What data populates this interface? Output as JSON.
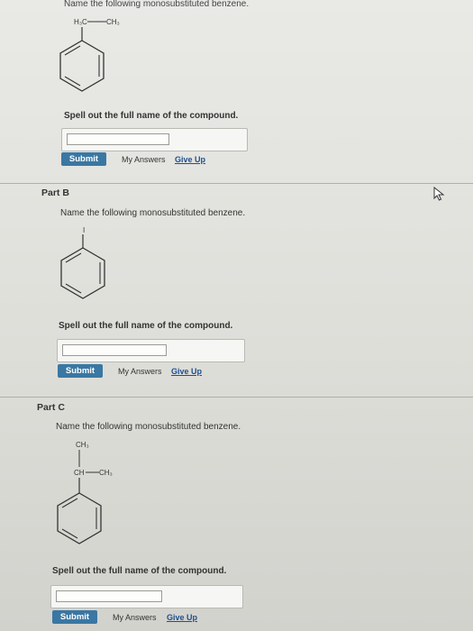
{
  "part_a": {
    "instruction": "Name the following monosubstituted benzene.",
    "sub_left": "H₃C",
    "sub_right": "CH₃",
    "prompt": "Spell out the full name of the compound.",
    "submit_label": "Submit",
    "my_answers_label": "My Answers",
    "give_up_label": "Give Up"
  },
  "part_b": {
    "title": "Part B",
    "instruction": "Name the following monosubstituted benzene.",
    "substituent": "I",
    "prompt": "Spell out the full name of the compound.",
    "submit_label": "Submit",
    "my_answers_label": "My Answers",
    "give_up_label": "Give Up"
  },
  "part_c": {
    "title": "Part C",
    "instruction": "Name the following monosubstituted benzene.",
    "sub_top": "CH₃",
    "sub_ch": "CH",
    "sub_ch3": "CH₃",
    "prompt": "Spell out the full name of the compound.",
    "submit_label": "Submit",
    "my_answers_label": "My Answers",
    "give_up_label": "Give Up"
  },
  "icons": {
    "cursor": "mouse-pointer-icon"
  }
}
